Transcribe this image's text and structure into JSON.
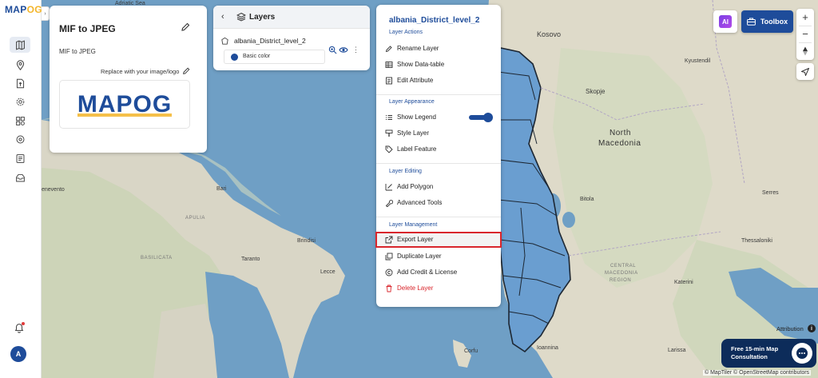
{
  "app": {
    "logo_text": "MAP",
    "logo_accent": "OG"
  },
  "sidebar": {
    "items": [
      {
        "icon": "map-icon",
        "active": true
      },
      {
        "icon": "location-pin-icon"
      },
      {
        "icon": "upload-file-icon"
      },
      {
        "icon": "settings-gear-icon"
      },
      {
        "icon": "analysis-icon"
      },
      {
        "icon": "globe-settings-icon"
      },
      {
        "icon": "report-icon"
      },
      {
        "icon": "inbox-icon"
      }
    ],
    "avatar_letter": "A"
  },
  "project": {
    "title": "MIF to JPEG",
    "description": "MIF to JPEG",
    "replace_label": "Replace with your image/logo",
    "logo_text": "MAPOG"
  },
  "layers_panel": {
    "title": "Layers",
    "layer_name": "albania_District_level_2",
    "style_label": "Basic color",
    "style_color": "#1e4c9a"
  },
  "layer_menu": {
    "title": "albania_District_level_2",
    "sections": {
      "actions": "Layer Actions",
      "appearance": "Layer Appearance",
      "editing": "Layer Editing",
      "management": "Layer Management"
    },
    "items": {
      "rename": "Rename Layer",
      "show_data_table": "Show Data-table",
      "edit_attribute": "Edit Attribute",
      "show_legend": "Show Legend",
      "style_layer": "Style Layer",
      "label_feature": "Label Feature",
      "add_polygon": "Add Polygon",
      "advanced_tools": "Advanced Tools",
      "export_layer": "Export Layer",
      "duplicate_layer": "Duplicate Layer",
      "add_credit": "Add Credit & License",
      "delete_layer": "Delete Layer"
    },
    "show_legend_on": true
  },
  "toolbar": {
    "ai_label": "AI",
    "toolbox_label": "Toolbox",
    "zoom_in": "+",
    "zoom_out": "−"
  },
  "map": {
    "labels": {
      "adriatic": "Adriatic Sea",
      "kosovo": "Kosovo",
      "skopje": "Skopje",
      "north_macedonia_1": "North",
      "north_macedonia_2": "Macedonia",
      "kyustendil": "Kyustendil",
      "bitola": "Bitola",
      "serres": "Serres",
      "thessaloniki": "Thessaloniki",
      "katerini": "Katerini",
      "ioannina": "Ioannina",
      "larissa": "Larissa",
      "corfu": "Corfu",
      "lecce": "Lecce",
      "brindisi": "Brindisi",
      "taranto": "Taranto",
      "bari": "Bari",
      "puglia": "APULIA",
      "basilicata": "BASILICATA",
      "benevento": "enevento",
      "central_macedonia_1": "CENTRAL",
      "central_macedonia_2": "MACEDONIA",
      "central_macedonia_3": "REGION"
    },
    "attribution": "Attribution",
    "copyright": "© MapTiler © OpenStreetMap contributors"
  },
  "consult": {
    "text": "Free 15-min Map Consultation"
  },
  "colors": {
    "brand": "#1e4c9a",
    "accent": "#f3b52a",
    "highlight": "#d9262c",
    "layer_fill": "#6a9ed0"
  }
}
